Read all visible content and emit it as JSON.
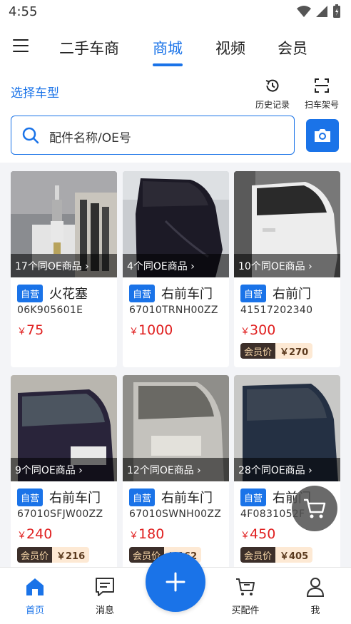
{
  "status_bar": {
    "time": "4:55"
  },
  "top_nav": {
    "tabs": [
      {
        "label": "二手车商"
      },
      {
        "label": "商城",
        "active": true
      },
      {
        "label": "视频"
      },
      {
        "label": "会员"
      }
    ]
  },
  "toolbar": {
    "choose_car": "选择车型",
    "history_label": "历史记录",
    "scan_label": "扫车架号"
  },
  "search": {
    "placeholder": "配件名称/OE号"
  },
  "products": [
    {
      "oe_count": "17个同OE商品 ›",
      "badge": "自营",
      "name": "火花塞",
      "code": "06K905601E",
      "currency": "￥",
      "price": "75",
      "vip_label": "",
      "vip_price": ""
    },
    {
      "oe_count": "4个同OE商品 ›",
      "badge": "自营",
      "name": "右前车门",
      "code": "67010TRNH00ZZ",
      "currency": "￥",
      "price": "1000",
      "vip_label": "",
      "vip_price": ""
    },
    {
      "oe_count": "10个同OE商品 ›",
      "badge": "自营",
      "name": "右前门",
      "code": "41517202340",
      "currency": "￥",
      "price": "300",
      "vip_label": "会员价",
      "vip_price": "￥270"
    },
    {
      "oe_count": "9个同OE商品 ›",
      "badge": "自营",
      "name": "右前车门",
      "code": "67010SFJW00ZZ",
      "currency": "￥",
      "price": "240",
      "vip_label": "会员价",
      "vip_price": "￥216"
    },
    {
      "oe_count": "12个同OE商品 ›",
      "badge": "自营",
      "name": "右前车门",
      "code": "67010SWNH00ZZ",
      "currency": "￥",
      "price": "180",
      "vip_label": "会员价",
      "vip_price": "￥162"
    },
    {
      "oe_count": "28个同OE商品 ›",
      "badge": "自营",
      "name": "右前门",
      "code": "4F0831052F",
      "currency": "￥",
      "price": "450",
      "vip_label": "会员价",
      "vip_price": "￥405"
    }
  ],
  "bottom_nav": {
    "items": [
      {
        "label": "首页",
        "icon": "home-icon",
        "active": true
      },
      {
        "label": "消息",
        "icon": "message-icon"
      },
      {
        "label": "买配件",
        "icon": "cart-icon"
      },
      {
        "label": "我",
        "icon": "user-icon"
      }
    ]
  },
  "colors": {
    "accent": "#1a73e8",
    "price": "#e02020",
    "vip_dark": "#3c2f2a",
    "vip_light": "#fde9d4"
  }
}
